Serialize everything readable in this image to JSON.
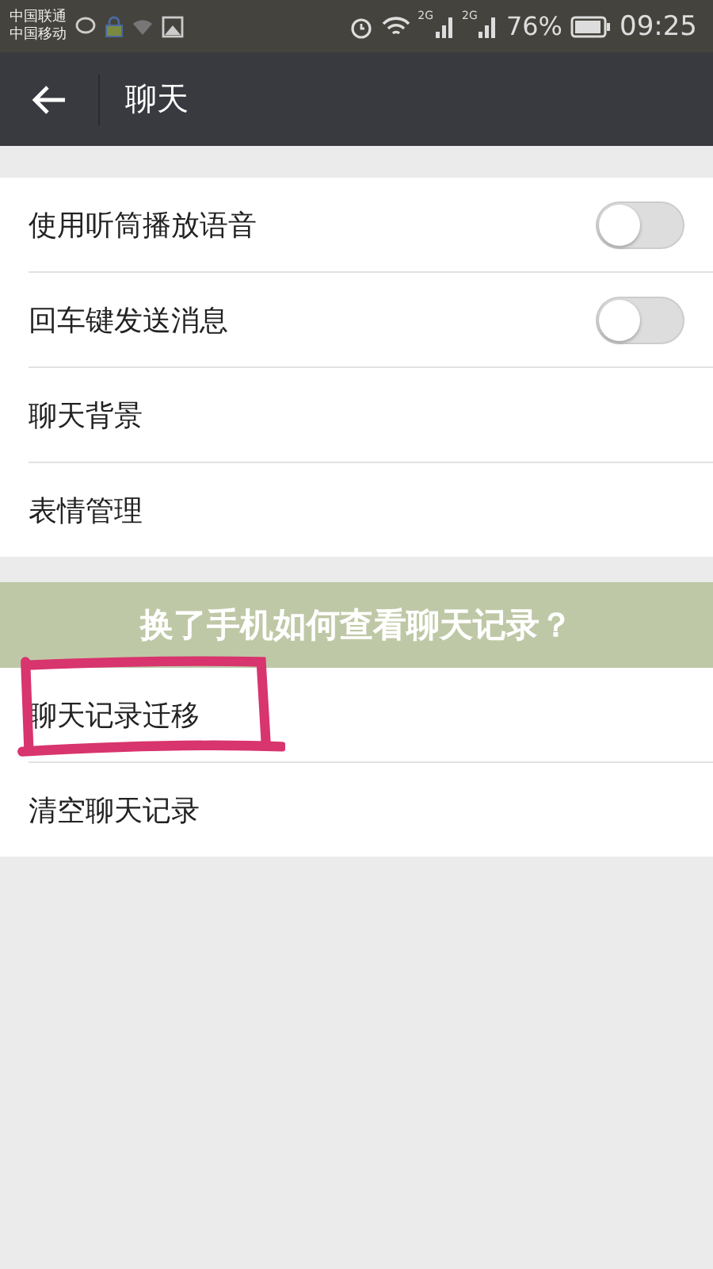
{
  "status_bar": {
    "carriers": [
      "中国联通",
      "中国移动"
    ],
    "sim_labels": [
      "2G",
      "2G"
    ],
    "battery": "76%",
    "time": "09:25"
  },
  "header": {
    "title": "聊天"
  },
  "groups": [
    {
      "rows": [
        {
          "kind": "toggle",
          "label": "使用听筒播放语音",
          "on": false
        },
        {
          "kind": "toggle",
          "label": "回车键发送消息",
          "on": false
        },
        {
          "kind": "plain",
          "label": "聊天背景"
        },
        {
          "kind": "plain",
          "label": "表情管理"
        }
      ]
    },
    {
      "rows": [
        {
          "kind": "plain",
          "label": "聊天记录迁移",
          "highlighted": true
        },
        {
          "kind": "plain",
          "label": "清空聊天记录"
        }
      ]
    }
  ],
  "banner": {
    "title": "换了手机如何查看聊天记录？"
  }
}
